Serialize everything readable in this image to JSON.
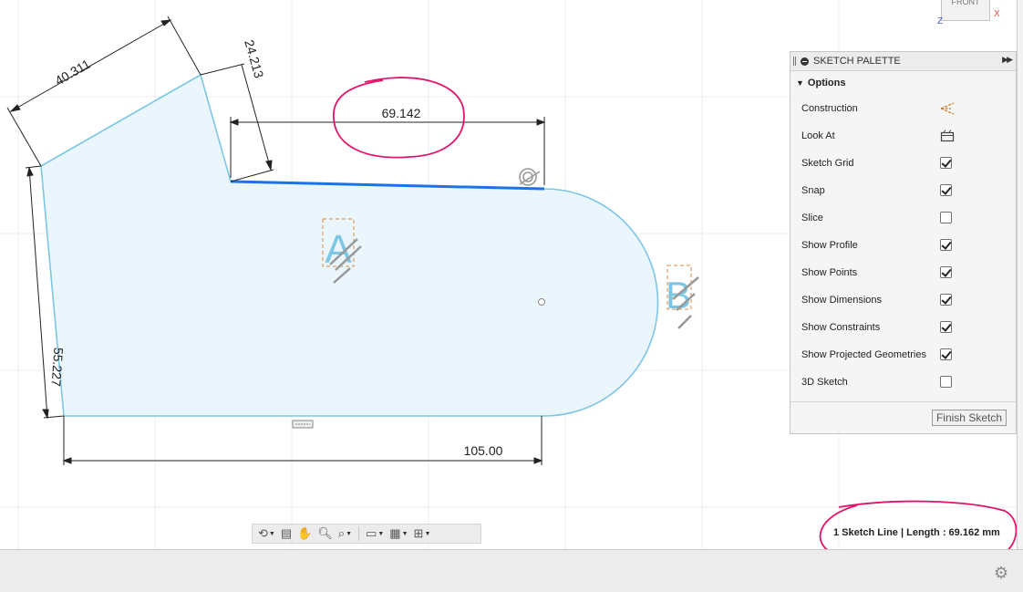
{
  "viewcube": {
    "face": "FRONT",
    "axis_x": "X",
    "axis_z": "Z"
  },
  "sketch": {
    "dimensions": {
      "top_length": "69.142",
      "slanted_left": "40.311",
      "slanted_right": "24.213",
      "left_height": "55.227",
      "bottom_length": "105.00"
    },
    "labels": {
      "point_a": "A",
      "point_b": "B"
    }
  },
  "palette": {
    "title": "SKETCH PALETTE",
    "section": "Options",
    "finish_label": "Finish Sketch",
    "rows": [
      {
        "label": "Construction",
        "type": "icon",
        "icon": "construction-icon"
      },
      {
        "label": "Look At",
        "type": "icon",
        "icon": "look-at-icon"
      },
      {
        "label": "Sketch Grid",
        "type": "checkbox",
        "checked": true
      },
      {
        "label": "Snap",
        "type": "checkbox",
        "checked": true
      },
      {
        "label": "Slice",
        "type": "checkbox",
        "checked": false
      },
      {
        "label": "Show Profile",
        "type": "checkbox",
        "checked": true
      },
      {
        "label": "Show Points",
        "type": "checkbox",
        "checked": true
      },
      {
        "label": "Show Dimensions",
        "type": "checkbox",
        "checked": true
      },
      {
        "label": "Show Constraints",
        "type": "checkbox",
        "checked": true
      },
      {
        "label": "Show Projected Geometries",
        "type": "checkbox",
        "checked": true
      },
      {
        "label": "3D Sketch",
        "type": "checkbox",
        "checked": false
      }
    ]
  },
  "status": {
    "text": "1 Sketch Line | Length : 69.162 mm"
  },
  "colors": {
    "sketch_stroke": "#7cc6e6",
    "selected_line": "#1a73e8",
    "profile_fill": "#eaf5fc",
    "annotation": "#e0156a"
  }
}
